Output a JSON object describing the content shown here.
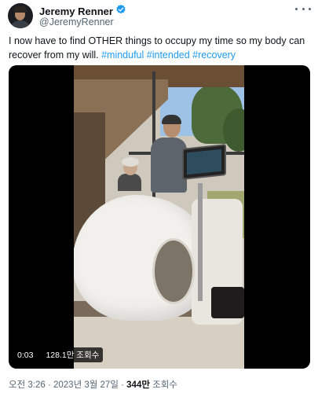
{
  "author": {
    "name": "Jeremy Renner",
    "handle": "@JeremyRenner",
    "verified": true,
    "verified_color": "#1d9bf0"
  },
  "tweet": {
    "text": "I now have to find OTHER things to occupy my time so my body can recover from my will.",
    "hashtags": [
      "#minduful",
      "#intended",
      "#recovery"
    ]
  },
  "video": {
    "elapsed": "0:03",
    "views": "128.1만 조회수"
  },
  "meta": {
    "time": "오전 3:26",
    "date": "2023년 3월 27일",
    "separator": "·",
    "views_count": "344만",
    "views_label": "조회수"
  },
  "icons": {
    "verified": "verified-badge-icon",
    "more": "more-options-icon"
  }
}
